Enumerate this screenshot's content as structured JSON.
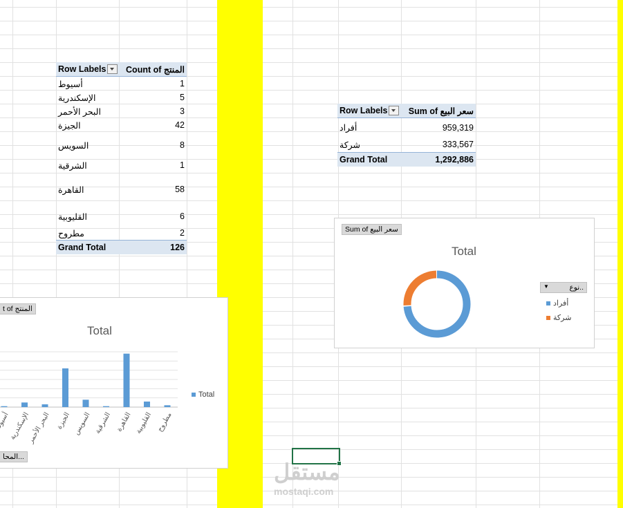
{
  "pivot_count": {
    "header_row_labels": "Row Labels",
    "header_value": "Count of المنتج",
    "rows": [
      {
        "label": "أسيوط",
        "value": "1"
      },
      {
        "label": "الإسكندرية",
        "value": "5"
      },
      {
        "label": "البحر الأحمر",
        "value": "3"
      },
      {
        "label": "الجيزة",
        "value": "42"
      },
      {
        "label": "السويس",
        "value": "8"
      },
      {
        "label": "الشرقية",
        "value": "1"
      },
      {
        "label": "القاهرة",
        "value": "58"
      },
      {
        "label": "القليوبية",
        "value": "6"
      },
      {
        "label": "مطروح",
        "value": "2"
      }
    ],
    "total_label": "Grand Total",
    "total_value": "126"
  },
  "pivot_sum": {
    "header_row_labels": "Row Labels",
    "header_value": "Sum of سعر البيع",
    "rows": [
      {
        "label": "أفراد",
        "value": "959,319"
      },
      {
        "label": "شركة",
        "value": "333,567"
      }
    ],
    "total_label": "Grand Total",
    "total_value": "1,292,886"
  },
  "bar_chart_box": {
    "field_button": "t of المنتج",
    "axis_button": "المحا...",
    "legend": "Total",
    "color": "#5b9bd5"
  },
  "donut_chart_box": {
    "field_button": "Sum of سعر البيع",
    "legend_filter": "نوع..",
    "legend_items": [
      {
        "label": "أفراد",
        "color": "#5b9bd5"
      },
      {
        "label": "شركة",
        "color": "#ed7d31"
      }
    ]
  },
  "chart_data": [
    {
      "type": "bar",
      "title": "Total",
      "categories": [
        "أسيوط",
        "الإسكندرية",
        "البحر الأحمر",
        "الجيزة",
        "السويس",
        "الشرقية",
        "القاهرة",
        "القليوبية",
        "مطروح"
      ],
      "series": [
        {
          "name": "Total",
          "values": [
            1,
            5,
            3,
            42,
            8,
            1,
            58,
            6,
            2
          ]
        }
      ],
      "legend": "right",
      "grid": true
    },
    {
      "type": "pie",
      "title": "Total",
      "categories": [
        "أفراد",
        "شركة"
      ],
      "values": [
        959319,
        333567
      ],
      "legend": "right"
    }
  ],
  "watermark": {
    "brand": "مستقل",
    "site": "mostaqi.com"
  }
}
